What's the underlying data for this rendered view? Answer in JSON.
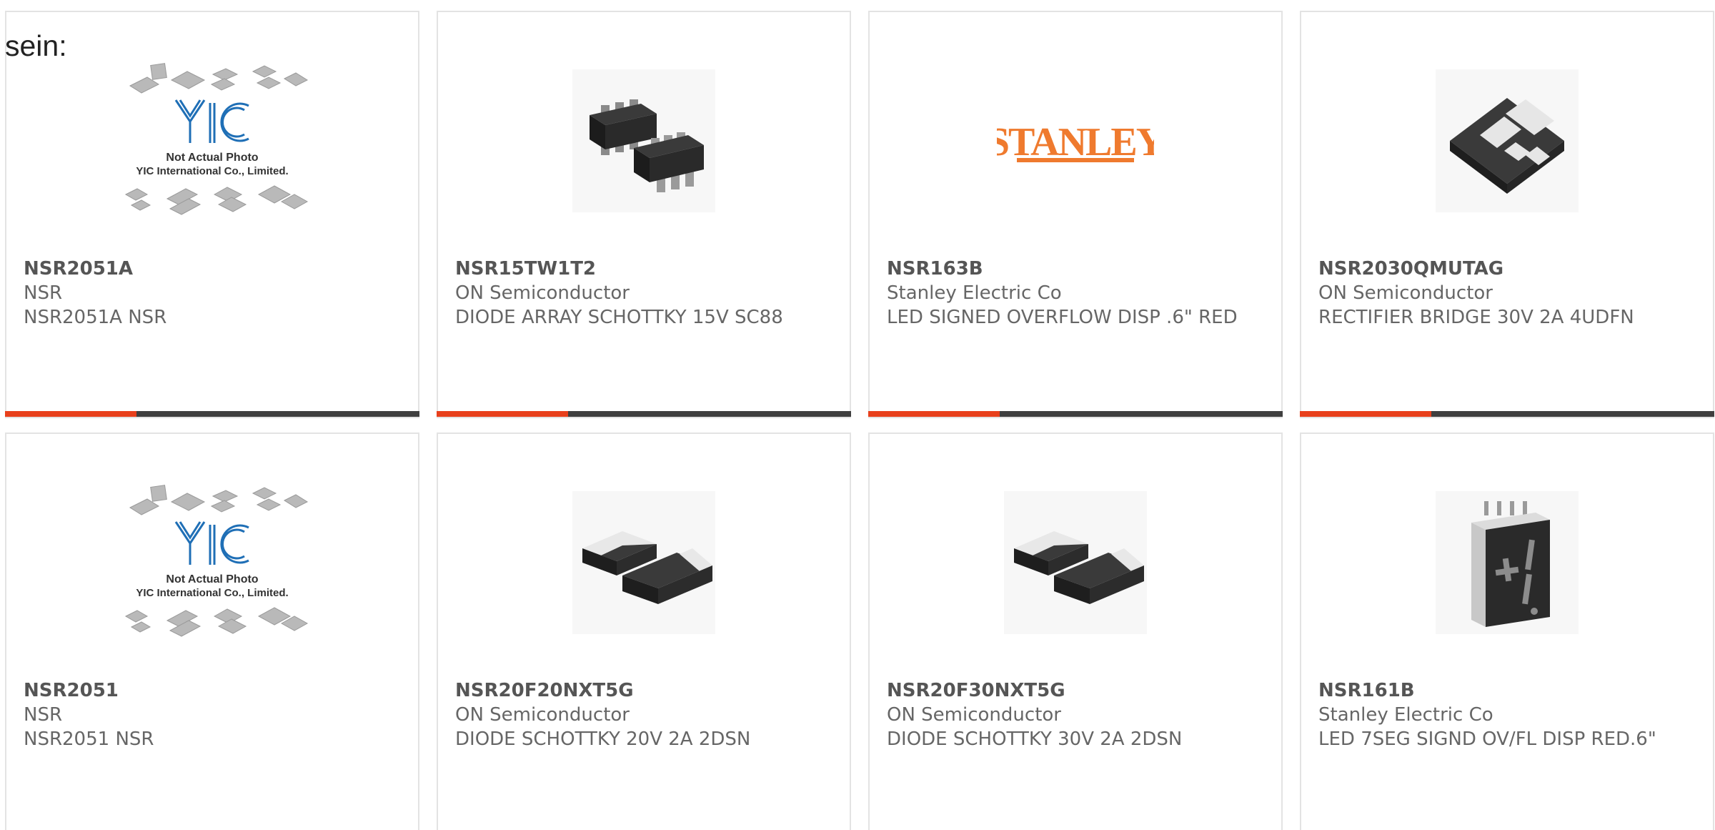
{
  "lead_text": "sein:",
  "colors": {
    "accent": "#e8401c",
    "bar_dark": "#3f3f3f",
    "border": "#e3e3e3",
    "text": "#666666"
  },
  "products": [
    {
      "part_number": "NSR2051A",
      "manufacturer": "NSR",
      "description": "NSR2051A NSR",
      "image": "yic-placeholder",
      "image_text": {
        "line1": "Not Actual Photo",
        "line2": "YIC International Co., Limited.",
        "logo": "YIC"
      }
    },
    {
      "part_number": "NSR15TW1T2",
      "manufacturer": "ON Semiconductor",
      "description": "DIODE ARRAY SCHOTTKY 15V SC88",
      "image": "sc88-package"
    },
    {
      "part_number": "NSR163B",
      "manufacturer": "Stanley Electric Co",
      "description": "LED SIGNED OVERFLOW DISP .6\" RED",
      "image": "stanley-logo",
      "image_text": {
        "logo": "STANLEY"
      }
    },
    {
      "part_number": "NSR2030QMUTAG",
      "manufacturer": "ON Semiconductor",
      "description": "RECTIFIER BRIDGE 30V 2A 4UDFN",
      "image": "udfn-package"
    },
    {
      "part_number": "NSR2051",
      "manufacturer": "NSR",
      "description": "NSR2051 NSR",
      "image": "yic-placeholder",
      "image_text": {
        "line1": "Not Actual Photo",
        "line2": "YIC International Co., Limited.",
        "logo": "YIC"
      }
    },
    {
      "part_number": "NSR20F20NXT5G",
      "manufacturer": "ON Semiconductor",
      "description": "DIODE SCHOTTKY 20V 2A 2DSN",
      "image": "dsn-package"
    },
    {
      "part_number": "NSR20F30NXT5G",
      "manufacturer": "ON Semiconductor",
      "description": "DIODE SCHOTTKY 30V 2A 2DSN",
      "image": "dsn-package"
    },
    {
      "part_number": "NSR161B",
      "manufacturer": "Stanley Electric Co",
      "description": "LED 7SEG SIGND OV/FL DISP RED.6\"",
      "image": "seven-seg-display"
    }
  ]
}
